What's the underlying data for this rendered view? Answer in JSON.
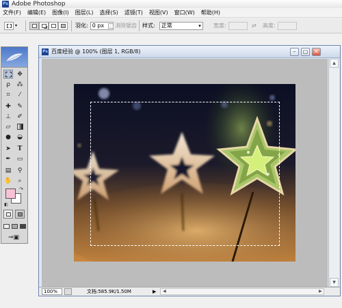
{
  "app": {
    "title": "Adobe Photoshop",
    "logo_text": "Ps"
  },
  "menu": [
    "文件(F)",
    "编辑(E)",
    "图像(I)",
    "图层(L)",
    "选择(S)",
    "滤镜(T)",
    "视图(V)",
    "窗口(W)",
    "帮助(H)"
  ],
  "options": {
    "feather_label": "羽化:",
    "feather_value": "0 px",
    "antialias_label": "消除锯齿",
    "style_label": "样式:",
    "style_value": "正常",
    "width_label": "宽度:",
    "height_label": "高度:"
  },
  "document": {
    "title": "百度经验 @ 100% (图层 1, RGB/8)",
    "zoom": "100%",
    "info": "文档:585.9K/1.50M"
  },
  "colors": {
    "foreground": "#f7c2d6",
    "background": "#ffffff"
  },
  "icons": {
    "toolbox": [
      "marquee",
      "move",
      "lasso",
      "magic-wand",
      "crop",
      "slice",
      "healing",
      "brush",
      "stamp",
      "history-brush",
      "eraser",
      "gradient",
      "blur",
      "dodge",
      "path-select",
      "type",
      "pen",
      "shape",
      "notes",
      "eyedropper",
      "hand",
      "zoom"
    ]
  }
}
